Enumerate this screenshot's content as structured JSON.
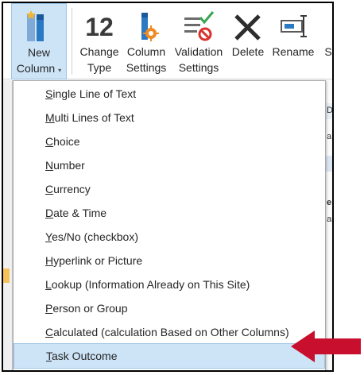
{
  "ribbon": {
    "new_column": {
      "line1": "New",
      "line2": "Column",
      "caret": "▾",
      "icon": "new-column-icon"
    },
    "change_type": {
      "glyph": "12",
      "line1": "Change",
      "line2": "Type",
      "icon": "change-type-icon"
    },
    "column_settings": {
      "line1": "Column",
      "line2": "Settings",
      "icon": "column-settings-icon"
    },
    "validation_settings": {
      "line1": "Validation",
      "line2": "Settings",
      "icon": "validation-settings-icon"
    },
    "delete": {
      "line1": "Delete",
      "icon": "delete-x-icon"
    },
    "rename": {
      "line1": "Rename",
      "icon": "rename-icon"
    },
    "next_cut": {
      "line1": "S"
    }
  },
  "background": {
    "right_text_1": "D",
    "right_text_2": "a",
    "right_text_3": "e",
    "right_text_4": "as"
  },
  "menu": {
    "items": [
      {
        "accel": "S",
        "rest": "ingle Line of Text"
      },
      {
        "accel": "M",
        "rest": "ulti Lines of Text"
      },
      {
        "accel": "C",
        "rest": "hoice"
      },
      {
        "accel": "N",
        "rest": "umber"
      },
      {
        "accel": "C",
        "rest": "urrency"
      },
      {
        "accel": "D",
        "rest": "ate & Time"
      },
      {
        "accel": "Y",
        "rest": "es/No (checkbox)"
      },
      {
        "accel": "H",
        "rest": "yperlink or Picture"
      },
      {
        "accel": "L",
        "rest": "ookup (Information Already on This Site)"
      },
      {
        "accel": "P",
        "rest": "erson or Group"
      },
      {
        "accel": "C",
        "rest": "alculated (calculation Based on Other Columns)"
      },
      {
        "accel": "T",
        "rest": "ask Outcome"
      }
    ],
    "highlighted_index": 11
  },
  "colors": {
    "highlight": "#cde4f7",
    "highlight_border": "#9cc6e8",
    "arrow": "#c8102e",
    "accent_blue": "#2b79c2"
  }
}
